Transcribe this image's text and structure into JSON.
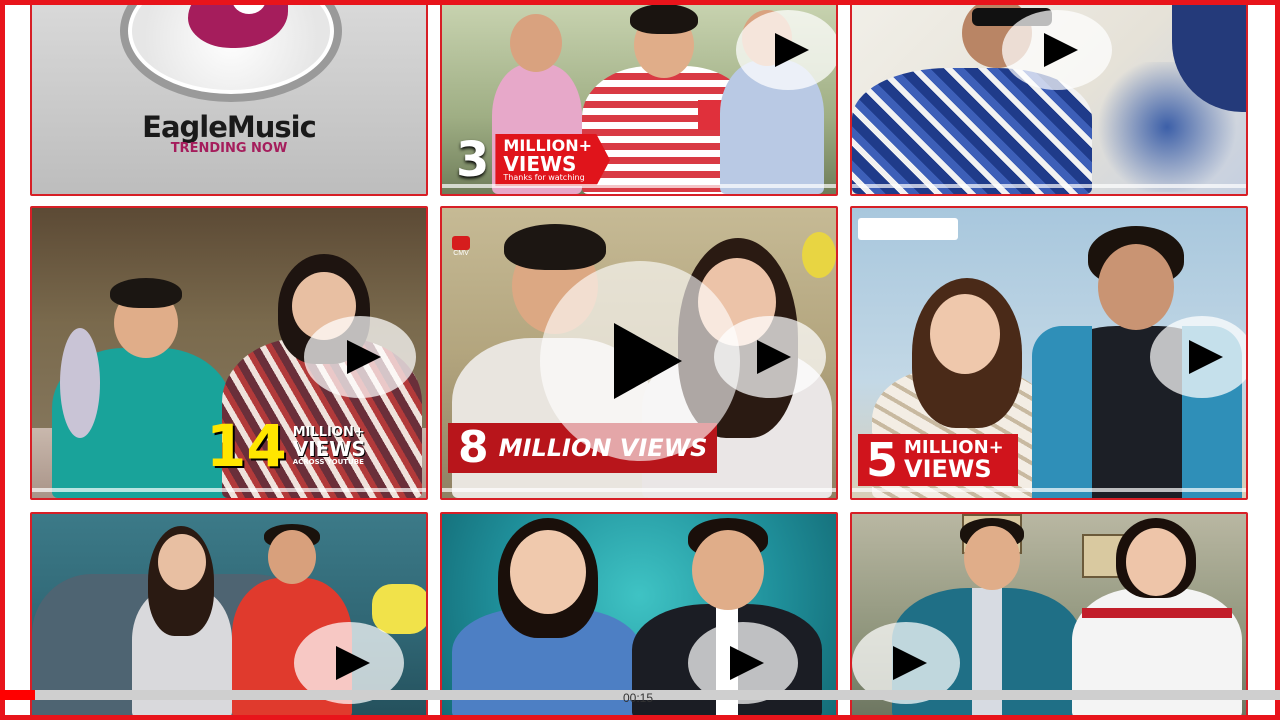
{
  "logo": {
    "brand": "EagleMusic",
    "tagline": "TRENDING NOW"
  },
  "tiles": [
    {
      "views_number": "3",
      "views_line1": "MILLION+",
      "views_line2": "VIEWS",
      "views_sub": "Thanks for watching"
    },
    {
      "views_number": "",
      "views_line1": "",
      "views_line2": "",
      "views_sub": ""
    },
    {
      "views_number": "14",
      "views_line1": "MILLION+",
      "views_line2": "VIEWS",
      "views_sub": "ACROSS YOUTUBE"
    },
    {
      "views_number": "8",
      "views_line1": "MILLION VIEWS",
      "views_line2": "",
      "views_sub": ""
    },
    {
      "views_number": "5",
      "views_line1": "MILLION+",
      "views_line2": "VIEWS",
      "views_sub": ""
    },
    {
      "views_number": "",
      "views_line1": "",
      "views_line2": "",
      "views_sub": ""
    },
    {
      "views_number": "",
      "views_line1": "",
      "views_line2": "",
      "views_sub": ""
    },
    {
      "views_number": "",
      "views_line1": "",
      "views_line2": "",
      "views_sub": ""
    }
  ],
  "tile_badges": {
    "cmv": "CMV"
  },
  "player": {
    "timecode": "00:15",
    "progress_fraction": 0.027
  },
  "colors": {
    "frame_red": "#e8141b",
    "play_overlay": "rgba(255,255,255,0.72)",
    "scrubber_played": "#ff0000",
    "scrubber_track": "#cfcfcf",
    "views_yellow": "#ffe600",
    "views_red": "#d9121b",
    "brand_purple": "#a51d5c"
  },
  "icons": {
    "play": "play-icon",
    "center_play": "large-play-icon"
  }
}
